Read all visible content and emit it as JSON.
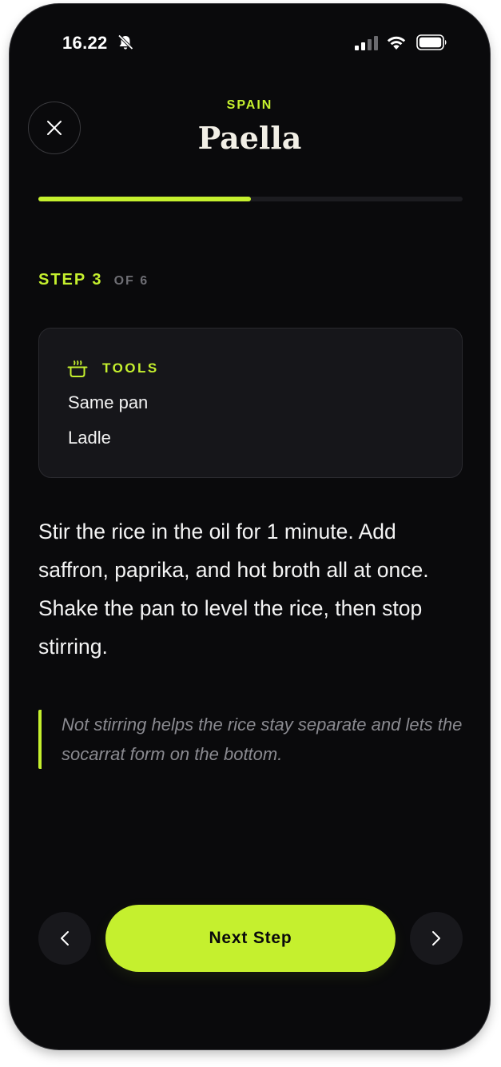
{
  "status_bar": {
    "time": "16.22"
  },
  "header": {
    "country": "SPAIN",
    "title": "Paella"
  },
  "progress": {
    "fraction": 0.5
  },
  "step": {
    "current_label": "STEP 3",
    "total_label": "OF 6"
  },
  "tools": {
    "title": "TOOLS",
    "items": [
      "Same pan",
      "Ladle"
    ]
  },
  "instruction": "Stir the rice in the oil for 1 minute. Add saffron, paprika, and hot broth all at once. Shake the pan to level the rice, then stop stirring.",
  "tip": "Not stirring helps the rice stay separate and lets the socarrat form on the bottom.",
  "nav": {
    "next_label": "Next Step"
  },
  "colors": {
    "accent": "#c5f02e",
    "background": "#0a0a0c",
    "card": "#16161a",
    "muted": "#8a8a90"
  },
  "icons": {
    "close": "close-icon",
    "tools": "pot-icon",
    "prev": "chevron-left-icon",
    "next": "chevron-right-icon",
    "bell": "bell-slash-icon",
    "signal": "cellular-signal-icon",
    "wifi": "wifi-icon",
    "battery": "battery-icon"
  }
}
